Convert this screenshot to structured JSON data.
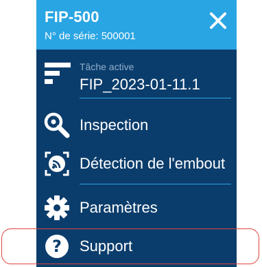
{
  "header": {
    "device_name": "FIP-500",
    "serial": "N° de série: 500001",
    "close_icon": "close-icon"
  },
  "task": {
    "label": "Tâche active",
    "value": "FIP_2023-01-11.1",
    "icon": "task-list-icon"
  },
  "menu": {
    "inspection": {
      "label": "Inspection",
      "icon": "magnifier-icon"
    },
    "tip_detection": {
      "label": "Détection de l'embout",
      "icon": "tip-detection-icon"
    },
    "settings": {
      "label": "Paramètres",
      "icon": "gear-icon"
    },
    "support": {
      "label": "Support",
      "icon": "help-icon"
    }
  },
  "colors": {
    "header_bg": "#2aa5e3",
    "panel_bg": "#0b3d6c",
    "accent_line": "#2aa5e3",
    "highlight_border": "#e0453c"
  }
}
